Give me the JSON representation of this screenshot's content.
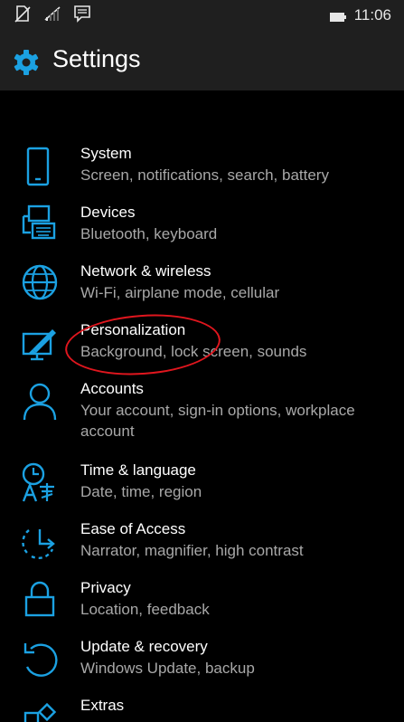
{
  "status_bar": {
    "time": "11:06",
    "icons": [
      "no-sim-icon",
      "signal-icon",
      "message-icon",
      "battery-icon"
    ]
  },
  "header": {
    "title": "Settings",
    "icon": "gear-icon"
  },
  "colors": {
    "accent": "#1ba1e2",
    "background": "#000000",
    "header_background": "#1f1f1f",
    "primary_text": "#ffffff",
    "secondary_text": "#a8a8a8",
    "annotation": "#e0161e"
  },
  "items": [
    {
      "name": "System",
      "description": "Screen, notifications, search, battery",
      "icon": "phone-icon"
    },
    {
      "name": "Devices",
      "description": "Bluetooth, keyboard",
      "icon": "devices-icon"
    },
    {
      "name": "Network & wireless",
      "description": "Wi-Fi, airplane mode, cellular",
      "icon": "globe-icon"
    },
    {
      "name": "Personalization",
      "description": "Background, lock screen, sounds",
      "icon": "personalization-icon"
    },
    {
      "name": "Accounts",
      "description": "Your account, sign-in options, workplace account",
      "icon": "person-icon"
    },
    {
      "name": "Time & language",
      "description": "Date, time, region",
      "icon": "time-language-icon"
    },
    {
      "name": "Ease of Access",
      "description": "Narrator, magnifier, high contrast",
      "icon": "ease-of-access-icon"
    },
    {
      "name": "Privacy",
      "description": "Location, feedback",
      "icon": "lock-icon"
    },
    {
      "name": "Update & recovery",
      "description": "Windows Update, backup",
      "icon": "update-icon"
    },
    {
      "name": "Extras",
      "description": "",
      "icon": "extras-icon"
    }
  ]
}
